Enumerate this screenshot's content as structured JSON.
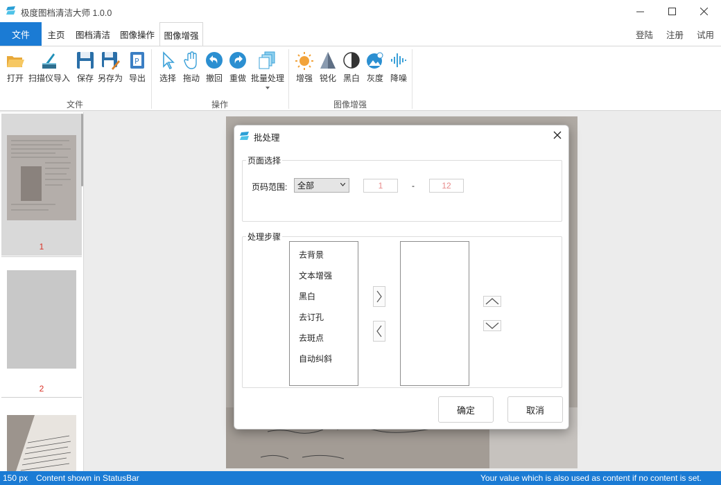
{
  "window": {
    "title": "极度图档清洁大师 1.0.0"
  },
  "ribbon_tabs": {
    "file": "文件",
    "tabs": [
      "主页",
      "图档清洁",
      "图像操作",
      "图像增强"
    ],
    "right": [
      "登陆",
      "注册",
      "试用"
    ]
  },
  "ribbon": {
    "groups": [
      {
        "label": "文件",
        "buttons": [
          "打开",
          "扫描仪导入",
          "保存",
          "另存为",
          "导出"
        ]
      },
      {
        "label": "操作",
        "buttons": [
          "选择",
          "拖动",
          "撤回",
          "重做",
          "批量处理"
        ]
      },
      {
        "label": "图像增强",
        "buttons": [
          "增强",
          "锐化",
          "黑白",
          "灰度",
          "降噪"
        ]
      }
    ]
  },
  "thumbnails": {
    "pages": [
      "1",
      "2"
    ]
  },
  "dialog": {
    "title": "批处理",
    "page_selection": {
      "legend": "页面选择",
      "range_label": "页码范围:",
      "range_value": "全部",
      "from": "1",
      "dash": "-",
      "to": "12"
    },
    "steps": {
      "legend": "处理步骤",
      "available": [
        "去背景",
        "文本增强",
        "黑白",
        "去订孔",
        "去斑点",
        "自动纠斜"
      ]
    },
    "ok": "确定",
    "cancel": "取消"
  },
  "statusbar": {
    "zoom": "150 px",
    "left_text": "Content shown in StatusBar",
    "right_text": "Your value which is also used as content if no content is set."
  },
  "colors": {
    "accent": "#1b7bd4",
    "page_number": "#d93025"
  }
}
